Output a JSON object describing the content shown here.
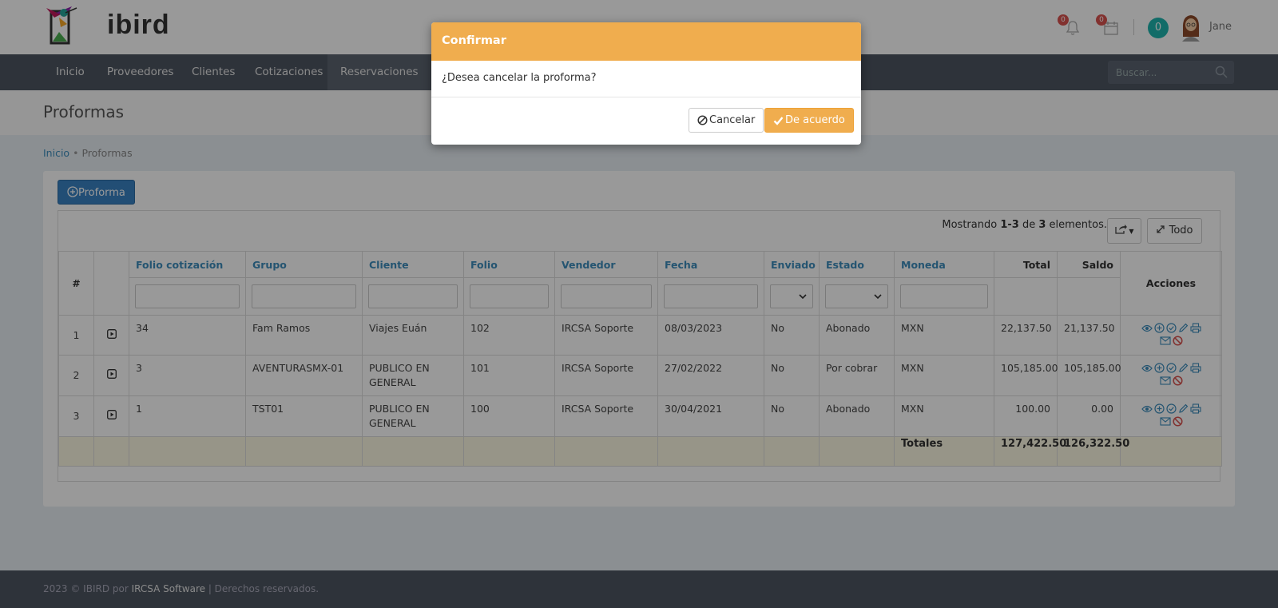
{
  "header": {
    "logo_text": "ibird",
    "notifications_count": "0",
    "calendar_count": "0",
    "messages_count": "0",
    "user_name": "Jane"
  },
  "nav": {
    "items": [
      {
        "label": "Inicio"
      },
      {
        "label": "Proveedores"
      },
      {
        "label": "Clientes"
      },
      {
        "label": "Cotizaciones"
      },
      {
        "label": "Reservaciones"
      }
    ],
    "search_placeholder": "Buscar..."
  },
  "page": {
    "title": "Proformas",
    "breadcrumb_home": "Inicio",
    "breadcrumb_current": "Proformas"
  },
  "grid": {
    "new_button": "Proforma",
    "summary_prefix": "Mostrando ",
    "summary_range": "1-3",
    "summary_mid": " de ",
    "summary_total": "3",
    "summary_suffix": " elementos.",
    "all_button": "Todo",
    "columns": {
      "num": "#",
      "folio_cot": "Folio cotización",
      "grupo": "Grupo",
      "cliente": "Cliente",
      "folio": "Folio",
      "vendedor": "Vendedor",
      "fecha": "Fecha",
      "enviado": "Enviado",
      "estado": "Estado",
      "moneda": "Moneda",
      "total": "Total",
      "saldo": "Saldo",
      "acciones": "Acciones"
    },
    "rows": [
      {
        "num": "1",
        "folio_cot": "34",
        "grupo": "Fam Ramos",
        "cliente": "Viajes Euán",
        "folio": "102",
        "vendedor": "IRCSA Soporte",
        "fecha": "08/03/2023",
        "enviado": "No",
        "estado": "Abonado",
        "moneda": "MXN",
        "total": "22,137.50",
        "saldo": "21,137.50"
      },
      {
        "num": "2",
        "folio_cot": "3",
        "grupo": "AVENTURASMX-01",
        "cliente": "PUBLICO EN GENERAL",
        "folio": "101",
        "vendedor": "IRCSA Soporte",
        "fecha": "27/02/2022",
        "enviado": "No",
        "estado": "Por cobrar",
        "moneda": "MXN",
        "total": "105,185.00",
        "saldo": "105,185.00"
      },
      {
        "num": "3",
        "folio_cot": "1",
        "grupo": "TST01",
        "cliente": "PUBLICO EN GENERAL",
        "folio": "100",
        "vendedor": "IRCSA Soporte",
        "fecha": "30/04/2021",
        "enviado": "No",
        "estado": "Abonado",
        "moneda": "MXN",
        "total": "100.00",
        "saldo": "0.00"
      }
    ],
    "totals_label": "Totales",
    "totals_total": "127,422.50",
    "totals_saldo": "126,322.50"
  },
  "footer": {
    "prefix": "2023 © IBIRD por ",
    "company": "IRCSA Software",
    "sep": " | ",
    "rights": "Derechos reservados."
  },
  "modal": {
    "title": "Confirmar",
    "message": "¿Desea cancelar la proforma?",
    "cancel_label": "Cancelar",
    "ok_label": "De acuerdo"
  },
  "colors": {
    "accent_warning": "#f0ad4e",
    "primary": "#3a82c4",
    "navbar": "#4e5662",
    "danger": "#d9534f",
    "info": "#1fb5ad"
  }
}
